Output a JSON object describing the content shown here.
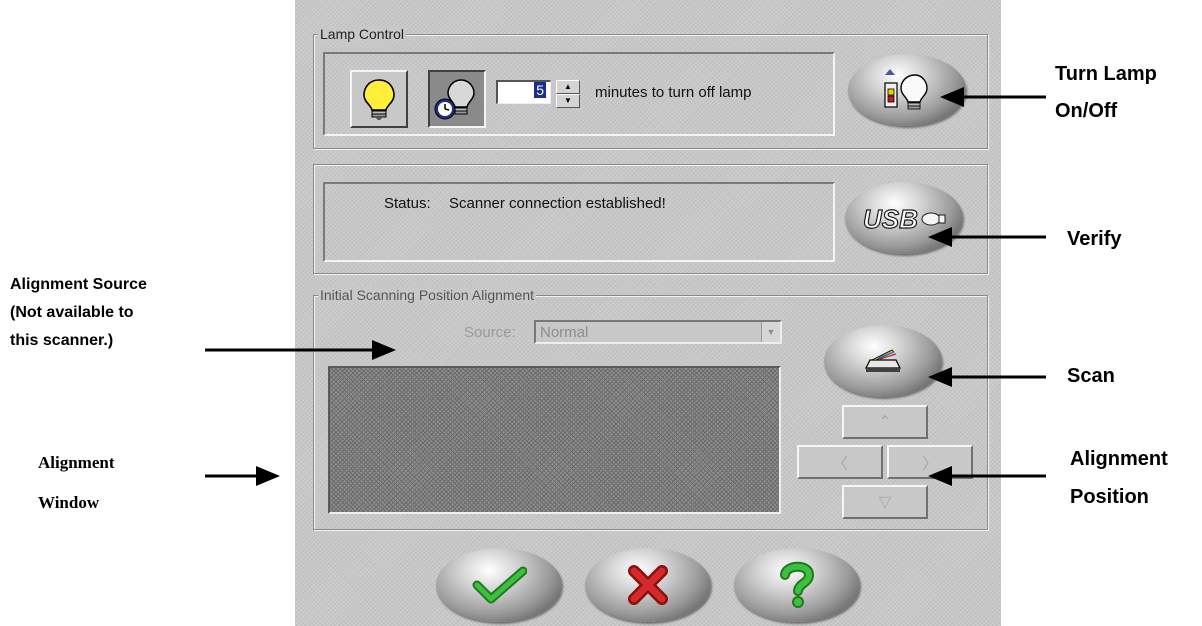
{
  "lamp_control": {
    "title": "Lamp Control",
    "minutes_value": "5",
    "minutes_label": "minutes to turn off lamp"
  },
  "status": {
    "label": "Status:",
    "text": "Scanner connection established!"
  },
  "alignment": {
    "title": "Initial Scanning Position Alignment",
    "source_label": "Source:",
    "source_value": "Normal"
  },
  "usb_button": {
    "text": "USB"
  },
  "annotations": {
    "turn_lamp_line1": "Turn Lamp",
    "turn_lamp_line2": "On/Off",
    "verify": "Verify",
    "alignment_source_line1": "Alignment Source",
    "alignment_source_line2": "(Not available to",
    "alignment_source_line3": "this scanner.)",
    "scan": "Scan",
    "alignment_window_line1": "Alignment",
    "alignment_window_line2": "Window",
    "alignment_position_line1": "Alignment",
    "alignment_position_line2": "Position"
  },
  "icons": {
    "lamp_on": "lightbulb-on-icon",
    "lamp_timer": "lightbulb-timer-icon",
    "lamp_switch": "lamp-switch-icon",
    "usb": "usb-icon",
    "scan": "scanner-icon",
    "ok": "checkmark-icon",
    "cancel": "x-icon",
    "help": "question-icon"
  },
  "colors": {
    "panel_bg": "#c8c8c8",
    "ok_green": "#2e9a2e",
    "cancel_red": "#c42020",
    "help_green": "#34a834",
    "bulb_yellow": "#ffee3a"
  }
}
